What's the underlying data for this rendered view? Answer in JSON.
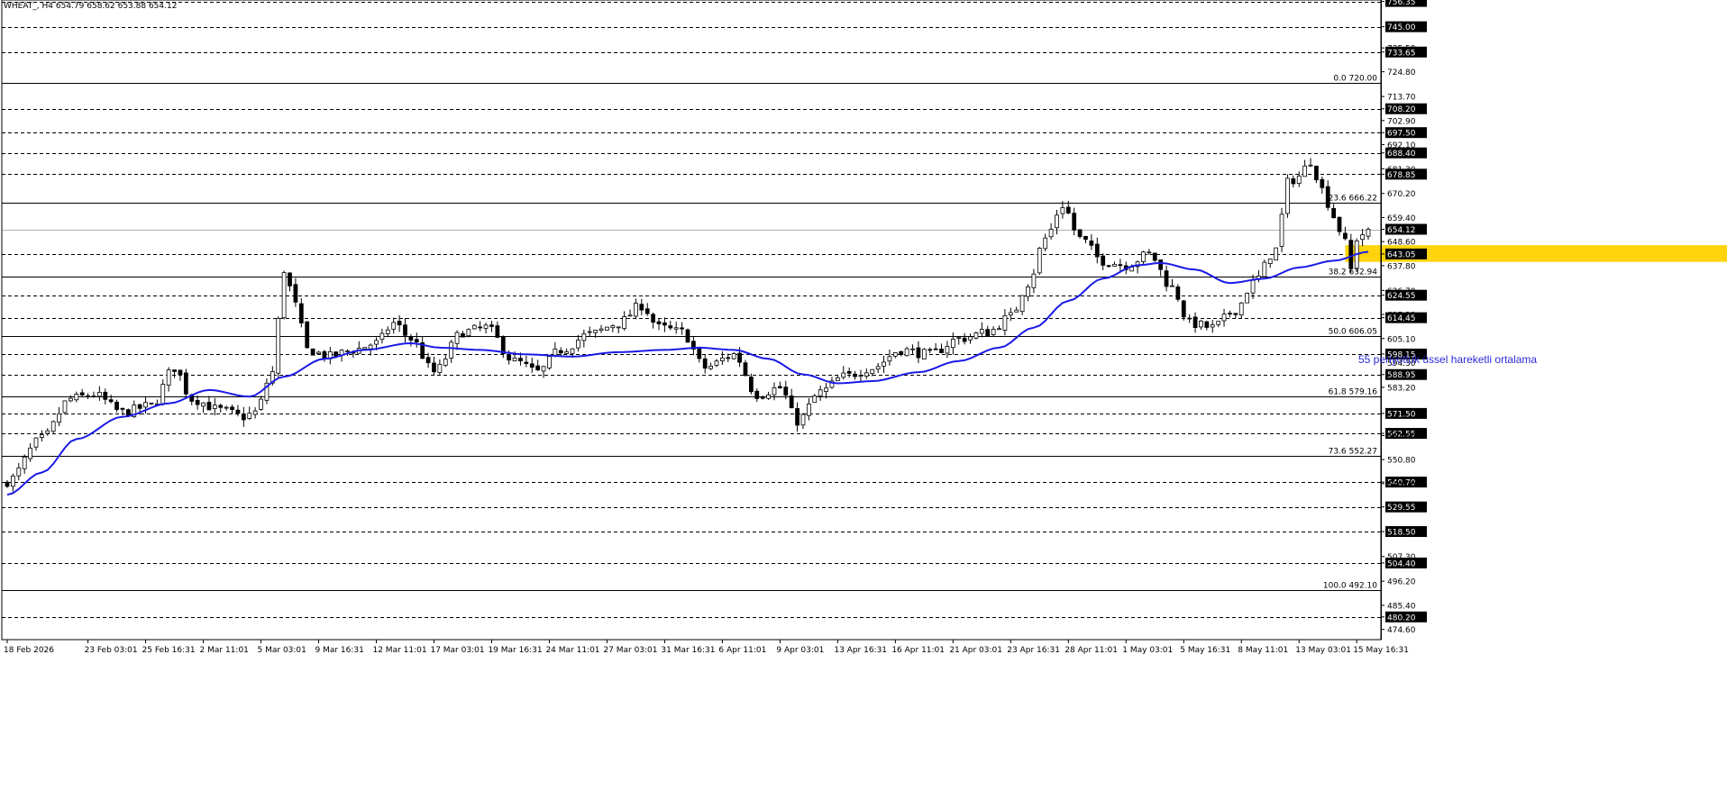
{
  "header": {
    "symbol_info": "WHEAT_, H4 654.79 658.62 653.88 654.12"
  },
  "annotation_text": "55 periyotluk üssel hareketli ortalama",
  "colors": {
    "background": "#ffffff",
    "candle_up": "#ffffff",
    "candle_down": "#000000",
    "candle_outline": "#000000",
    "ema": "#1a1ae6",
    "zone": "#ffd200",
    "grid": "#000000",
    "price_tag_bg": "#000000",
    "price_tag_text": "#ffffff",
    "annotation": "#2b2bd6"
  },
  "chart_data": {
    "type": "candlestick",
    "symbol": "WHEAT_",
    "timeframe": "H4",
    "ylim": [
      470.0,
      757.0
    ],
    "current_price": 654.12,
    "y_ticks": [
      {
        "value": 756.35,
        "label": "756.35",
        "tag": true
      },
      {
        "value": 745.0,
        "label": "745.00",
        "tag": true
      },
      {
        "value": 735.5,
        "label": "735.50",
        "tag": false
      },
      {
        "value": 733.65,
        "label": "733.65",
        "tag": true
      },
      {
        "value": 724.8,
        "label": "724.80",
        "tag": false
      },
      {
        "value": 713.7,
        "label": "713.70",
        "tag": false
      },
      {
        "value": 708.2,
        "label": "708.20",
        "tag": true
      },
      {
        "value": 702.9,
        "label": "702.90",
        "tag": false
      },
      {
        "value": 697.5,
        "label": "697.50",
        "tag": true
      },
      {
        "value": 692.1,
        "label": "692.10",
        "tag": false
      },
      {
        "value": 688.4,
        "label": "688.40",
        "tag": true
      },
      {
        "value": 681.3,
        "label": "681.30",
        "tag": false
      },
      {
        "value": 678.85,
        "label": "678.85",
        "tag": true
      },
      {
        "value": 670.2,
        "label": "670.20",
        "tag": false
      },
      {
        "value": 659.4,
        "label": "659.40",
        "tag": false
      },
      {
        "value": 654.12,
        "label": "654.12",
        "tag": true
      },
      {
        "value": 648.6,
        "label": "648.60",
        "tag": false
      },
      {
        "value": 643.05,
        "label": "643.05",
        "tag": true
      },
      {
        "value": 637.8,
        "label": "637.80",
        "tag": false
      },
      {
        "value": 626.7,
        "label": "626.70",
        "tag": false
      },
      {
        "value": 624.55,
        "label": "624.55",
        "tag": true
      },
      {
        "value": 615.9,
        "label": "615.90",
        "tag": false
      },
      {
        "value": 614.45,
        "label": "614.45",
        "tag": true
      },
      {
        "value": 605.1,
        "label": "605.10",
        "tag": false
      },
      {
        "value": 598.15,
        "label": "598.15",
        "tag": true
      },
      {
        "value": 594.3,
        "label": "594.30",
        "tag": false
      },
      {
        "value": 588.95,
        "label": "588.95",
        "tag": true
      },
      {
        "value": 583.2,
        "label": "583.20",
        "tag": false
      },
      {
        "value": 571.5,
        "label": "571.50",
        "tag": true
      },
      {
        "value": 562.55,
        "label": "562.55",
        "tag": true
      },
      {
        "value": 561.6,
        "label": "561.60",
        "tag": false
      },
      {
        "value": 550.8,
        "label": "550.80",
        "tag": false
      },
      {
        "value": 540.7,
        "label": "540.70",
        "tag": true
      },
      {
        "value": 540.0,
        "label": "540.00",
        "tag": false
      },
      {
        "value": 529.55,
        "label": "529.55",
        "tag": true
      },
      {
        "value": 518.5,
        "label": "518.50",
        "tag": true
      },
      {
        "value": 507.3,
        "label": "507.30",
        "tag": false
      },
      {
        "value": 504.4,
        "label": "504.40",
        "tag": true
      },
      {
        "value": 496.2,
        "label": "496.20",
        "tag": false
      },
      {
        "value": 485.4,
        "label": "485.40",
        "tag": false
      },
      {
        "value": 480.2,
        "label": "480.20",
        "tag": true
      },
      {
        "value": 474.6,
        "label": "474.60",
        "tag": false
      }
    ],
    "support_resistance_levels": [
      756.35,
      745.0,
      733.65,
      708.2,
      697.5,
      688.4,
      678.85,
      643.05,
      624.55,
      614.45,
      598.15,
      588.95,
      571.5,
      562.55,
      540.7,
      529.55,
      518.5,
      504.4,
      480.2
    ],
    "fibonacci_levels": [
      {
        "label": "0.0 720.00",
        "value": 720.0
      },
      {
        "label": "23.6 666.22",
        "value": 666.22
      },
      {
        "label": "38.2 632.94",
        "value": 632.94
      },
      {
        "label": "50.0 606.05",
        "value": 606.05
      },
      {
        "label": "61.8 579.16",
        "value": 579.16
      },
      {
        "label": "73.6 552.27",
        "value": 552.27
      },
      {
        "label": "100.0 492.10",
        "value": 492.1
      }
    ],
    "zone": {
      "low": 639.5,
      "high": 647.0,
      "start_bar": 232,
      "end_bar": 299
    },
    "x_labels": [
      {
        "bar": 0,
        "label": "18 Feb 2026"
      },
      {
        "bar": 14,
        "label": "23 Feb 03:01"
      },
      {
        "bar": 24,
        "label": "25 Feb 16:31"
      },
      {
        "bar": 34,
        "label": "2 Mar 11:01"
      },
      {
        "bar": 44,
        "label": "5 Mar 03:01"
      },
      {
        "bar": 54,
        "label": "9 Mar 16:31"
      },
      {
        "bar": 64,
        "label": "12 Mar 11:01"
      },
      {
        "bar": 74,
        "label": "17 Mar 03:01"
      },
      {
        "bar": 84,
        "label": "19 Mar 16:31"
      },
      {
        "bar": 94,
        "label": "24 Mar 11:01"
      },
      {
        "bar": 104,
        "label": "27 Mar 03:01"
      },
      {
        "bar": 114,
        "label": "31 Mar 16:31"
      },
      {
        "bar": 124,
        "label": "6 Apr 11:01"
      },
      {
        "bar": 134,
        "label": "9 Apr 03:01"
      },
      {
        "bar": 144,
        "label": "13 Apr 16:31"
      },
      {
        "bar": 154,
        "label": "16 Apr 11:01"
      },
      {
        "bar": 164,
        "label": "21 Apr 03:01"
      },
      {
        "bar": 174,
        "label": "23 Apr 16:31"
      },
      {
        "bar": 184,
        "label": "28 Apr 11:01"
      },
      {
        "bar": 194,
        "label": "1 May 03:01"
      },
      {
        "bar": 204,
        "label": "5 May 16:31"
      },
      {
        "bar": 214,
        "label": "8 May 11:01"
      },
      {
        "bar": 224,
        "label": "13 May 03:01"
      },
      {
        "bar": 234,
        "label": "15 May 16:31"
      }
    ],
    "close_anchors": [
      [
        0,
        541
      ],
      [
        6,
        560
      ],
      [
        11,
        578
      ],
      [
        15,
        580
      ],
      [
        20,
        572
      ],
      [
        25,
        575
      ],
      [
        29,
        592
      ],
      [
        32,
        578
      ],
      [
        37,
        573
      ],
      [
        41,
        570
      ],
      [
        43,
        572
      ],
      [
        46,
        590
      ],
      [
        48,
        636
      ],
      [
        50,
        620
      ],
      [
        52,
        600
      ],
      [
        56,
        597
      ],
      [
        60,
        600
      ],
      [
        64,
        603
      ],
      [
        67,
        612
      ],
      [
        70,
        605
      ],
      [
        74,
        590
      ],
      [
        79,
        608
      ],
      [
        83,
        610
      ],
      [
        88,
        595
      ],
      [
        92,
        590
      ],
      [
        96,
        600
      ],
      [
        101,
        607
      ],
      [
        106,
        612
      ],
      [
        110,
        620
      ],
      [
        113,
        610
      ],
      [
        117,
        608
      ],
      [
        121,
        592
      ],
      [
        126,
        598
      ],
      [
        130,
        580
      ],
      [
        134,
        583
      ],
      [
        137,
        568
      ],
      [
        141,
        581
      ],
      [
        145,
        588
      ],
      [
        150,
        592
      ],
      [
        155,
        600
      ],
      [
        160,
        598
      ],
      [
        165,
        605
      ],
      [
        170,
        608
      ],
      [
        174,
        615
      ],
      [
        177,
        630
      ],
      [
        180,
        650
      ],
      [
        183,
        665
      ],
      [
        186,
        650
      ],
      [
        190,
        640
      ],
      [
        194,
        638
      ],
      [
        198,
        643
      ],
      [
        202,
        628
      ],
      [
        205,
        612
      ],
      [
        209,
        610
      ],
      [
        213,
        618
      ],
      [
        216,
        630
      ],
      [
        220,
        645
      ],
      [
        222,
        675
      ],
      [
        224,
        678
      ],
      [
        226,
        685
      ],
      [
        228,
        672
      ],
      [
        230,
        660
      ],
      [
        232,
        648
      ],
      [
        233,
        636
      ],
      [
        234,
        650
      ],
      [
        236,
        654.12
      ]
    ],
    "ema_period": 55,
    "ema_anchors": [
      [
        0,
        535
      ],
      [
        6,
        545
      ],
      [
        12,
        560
      ],
      [
        20,
        570
      ],
      [
        28,
        576
      ],
      [
        35,
        582
      ],
      [
        42,
        579
      ],
      [
        48,
        588
      ],
      [
        55,
        596
      ],
      [
        62,
        600
      ],
      [
        70,
        603
      ],
      [
        75,
        601
      ],
      [
        82,
        600
      ],
      [
        90,
        598
      ],
      [
        98,
        597
      ],
      [
        106,
        599
      ],
      [
        114,
        600
      ],
      [
        120,
        601
      ],
      [
        126,
        600
      ],
      [
        132,
        596
      ],
      [
        138,
        589
      ],
      [
        144,
        585
      ],
      [
        150,
        586
      ],
      [
        158,
        590
      ],
      [
        165,
        595
      ],
      [
        172,
        601
      ],
      [
        178,
        610
      ],
      [
        184,
        622
      ],
      [
        190,
        632
      ],
      [
        196,
        638
      ],
      [
        200,
        639
      ],
      [
        206,
        636
      ],
      [
        212,
        630
      ],
      [
        218,
        632
      ],
      [
        224,
        637
      ],
      [
        230,
        640
      ],
      [
        236,
        644
      ]
    ],
    "total_bars": 237
  }
}
